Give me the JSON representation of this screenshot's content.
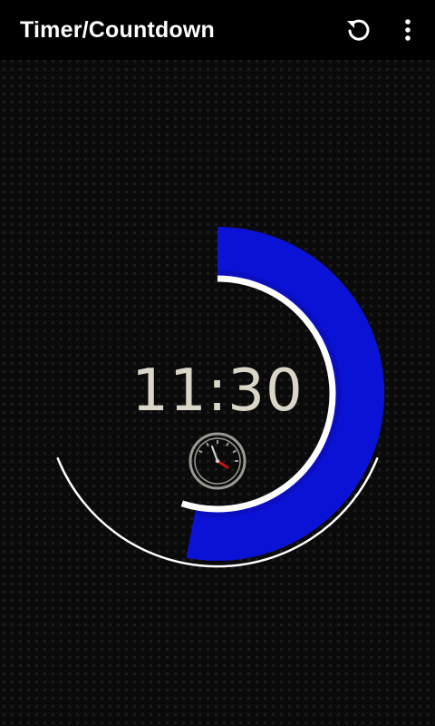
{
  "app": {
    "title": "Timer/Countdown"
  },
  "toolbar": {
    "reset_icon": "reset-icon",
    "overflow_icon": "more-vertical-icon"
  },
  "timer": {
    "display": "11:30",
    "progress": 0.53,
    "inner_progress": 0.55,
    "stopwatch_icon": "stopwatch-icon"
  },
  "colors": {
    "background": "#0a0a0a",
    "action_bar": "#000000",
    "title_text": "#ffffff",
    "progress_arc": "#0a12d6",
    "progress_arc_edge": "#0c0ca8",
    "inner_ring": "#ffffff",
    "time_text": "#d9d6c8",
    "stopwatch_hand": "#cc1111"
  }
}
